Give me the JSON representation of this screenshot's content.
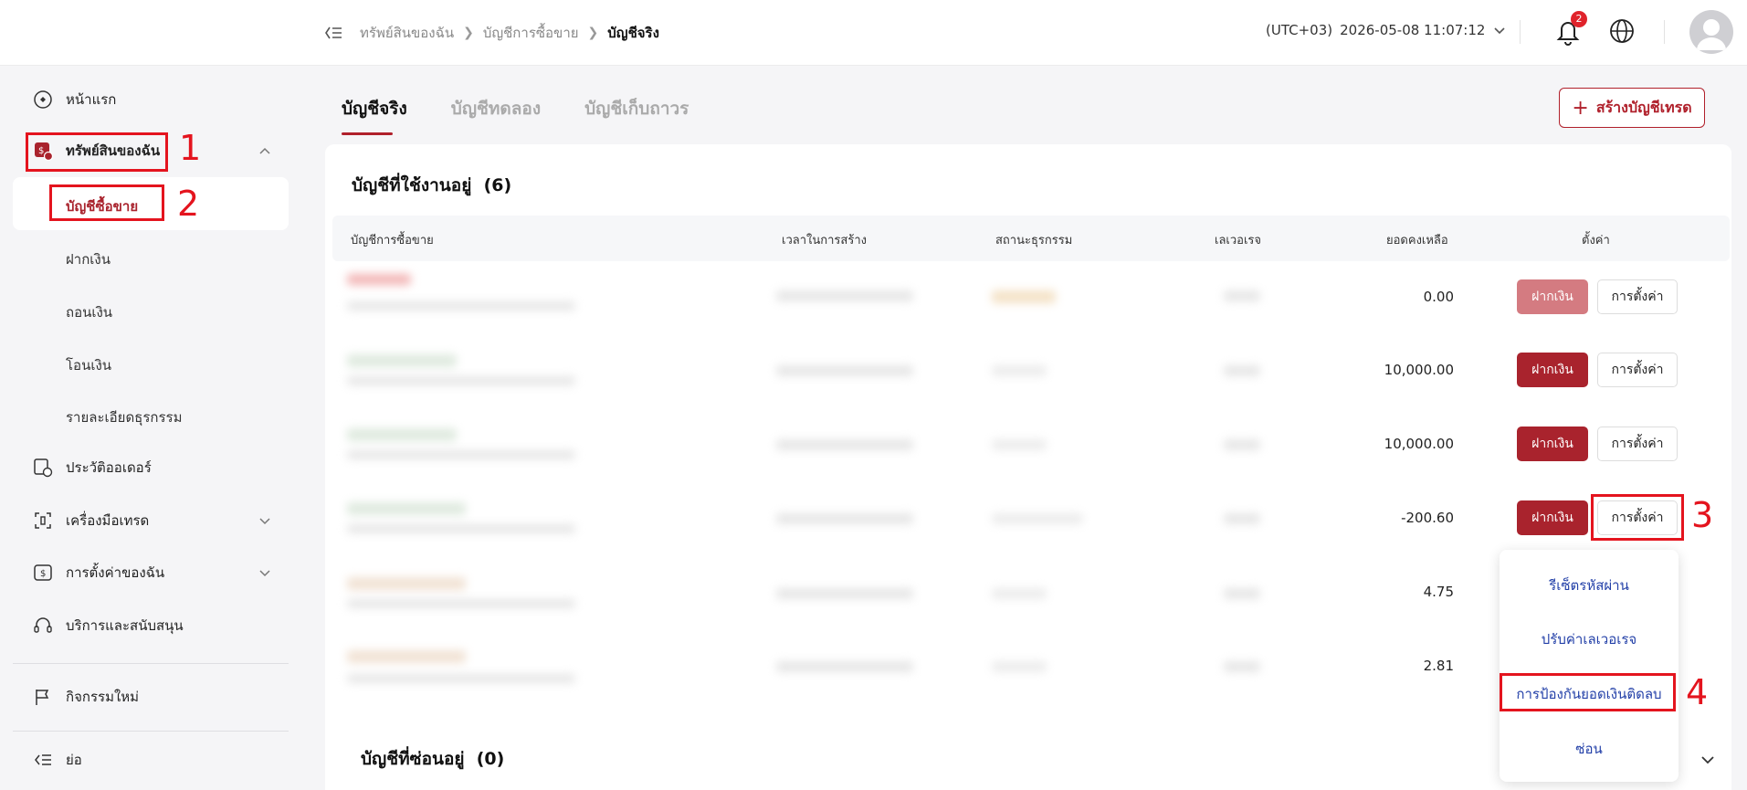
{
  "header": {
    "breadcrumb": [
      "ทรัพย์สินของฉัน",
      "บัญชีการซื้อขาย",
      "บัญชีจริง"
    ],
    "timezone": "(UTC+03)",
    "datetime": "2026-05-08 11:07:12",
    "notification_count": "2"
  },
  "sidebar": {
    "items": [
      {
        "label": "หน้าแรก",
        "icon": "home-icon"
      },
      {
        "label": "ทรัพย์สินของฉัน",
        "icon": "assets-icon"
      },
      {
        "label": "ประวัติออเดอร์",
        "icon": "order-history-icon"
      },
      {
        "label": "เครื่องมือเทรด",
        "icon": "trading-tools-icon"
      },
      {
        "label": "การตั้งค่าของฉัน",
        "icon": "settings-icon"
      },
      {
        "label": "บริการและสนับสนุน",
        "icon": "support-icon"
      },
      {
        "label": "กิจกรรมใหม่",
        "icon": "flag-icon"
      },
      {
        "label": "ย่อ",
        "icon": "collapse-icon"
      }
    ],
    "sub_items": [
      "บัญชีซื้อขาย",
      "ฝากเงิน",
      "ถอนเงิน",
      "โอนเงิน",
      "รายละเอียดธุรกรรม"
    ]
  },
  "main": {
    "tabs": [
      "บัญชีจริง",
      "บัญชีทดลอง",
      "บัญชีเก็บถาวร"
    ],
    "create_button": "สร้างบัญชีเทรด",
    "active_title": "บัญชีที่ใช้งานอยู่",
    "active_count": "(6)",
    "hidden_title": "บัญชีที่ซ่อนอยู่",
    "hidden_count": "(0)",
    "columns": [
      "บัญชีการซื้อขาย",
      "เวลาในการสร้าง",
      "สถานะธุรกรรม",
      "เลเวอเรจ",
      "ยอดคงเหลือ",
      "ตั้งค่า"
    ],
    "rows": [
      {
        "balance": "0.00",
        "deposit": "ฝากเงิน",
        "settings": "การตั้งค่า"
      },
      {
        "balance": "10,000.00",
        "deposit": "ฝากเงิน",
        "settings": "การตั้งค่า"
      },
      {
        "balance": "10,000.00",
        "deposit": "ฝากเงิน",
        "settings": "การตั้งค่า"
      },
      {
        "balance": "-200.60",
        "deposit": "ฝากเงิน",
        "settings": "การตั้งค่า"
      },
      {
        "balance": "4.75"
      },
      {
        "balance": "2.81"
      }
    ],
    "dropdown": [
      "รีเซ็ตรหัสผ่าน",
      "ปรับค่าเลเวอเรจ",
      "การป้องกันยอดเงินติดลบ",
      "ซ่อน"
    ]
  },
  "annotations": [
    "1",
    "2",
    "3",
    "4"
  ],
  "colors": {
    "accent": "#a9232d",
    "highlight": "#e4141e",
    "link": "#2340a8"
  }
}
